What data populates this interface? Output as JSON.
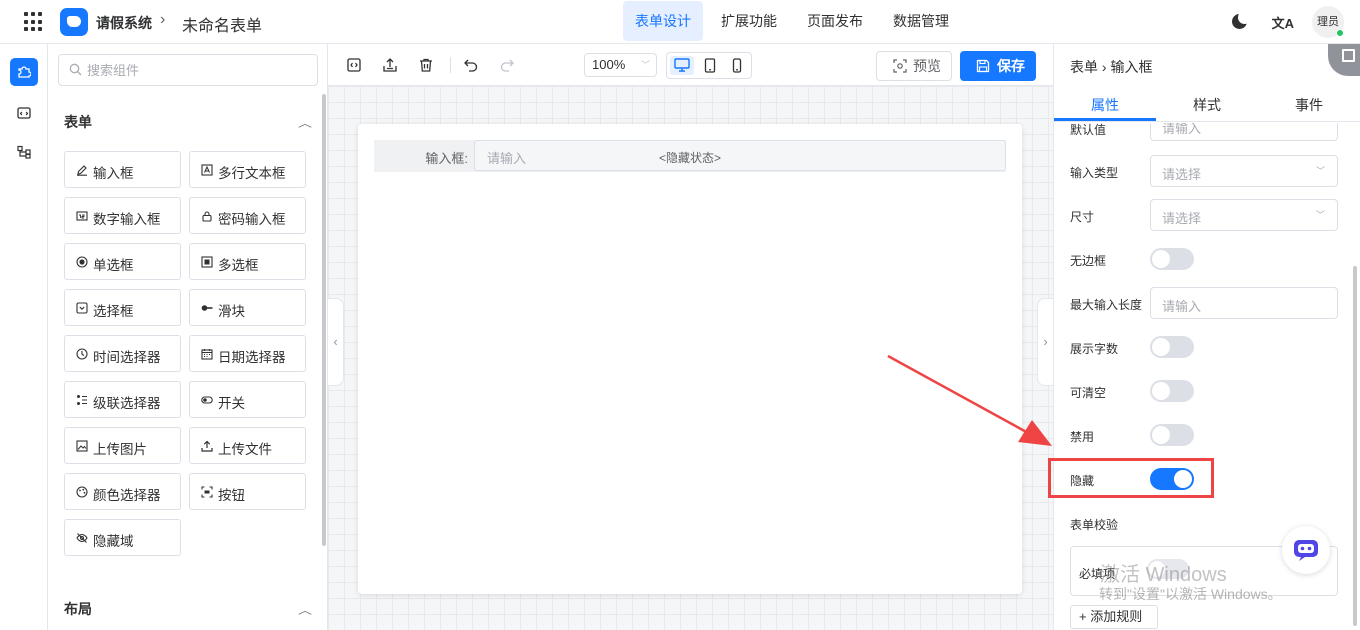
{
  "header": {
    "app_title": "请假系统",
    "crumb_sep": "›",
    "form_name": "未命名表单",
    "nav": [
      {
        "label": "表单设计",
        "active": true
      },
      {
        "label": "扩展功能",
        "active": false
      },
      {
        "label": "页面发布",
        "active": false
      },
      {
        "label": "数据管理",
        "active": false
      }
    ],
    "lang_icon": "文A",
    "user": "理员",
    "accent": "#1677ff"
  },
  "components": {
    "search_placeholder": "搜索组件",
    "sections": [
      {
        "title": "表单",
        "items": [
          {
            "label": "输入框",
            "icon": "pencil-icon"
          },
          {
            "label": "多行文本框",
            "icon": "textarea-icon"
          },
          {
            "label": "数字输入框",
            "icon": "number-icon"
          },
          {
            "label": "密码输入框",
            "icon": "lock-icon"
          },
          {
            "label": "单选框",
            "icon": "radio-icon"
          },
          {
            "label": "多选框",
            "icon": "checkbox-icon"
          },
          {
            "label": "选择框",
            "icon": "select-icon"
          },
          {
            "label": "滑块",
            "icon": "slider-icon"
          },
          {
            "label": "时间选择器",
            "icon": "clock-icon"
          },
          {
            "label": "日期选择器",
            "icon": "calendar-icon"
          },
          {
            "label": "级联选择器",
            "icon": "cascader-icon"
          },
          {
            "label": "开关",
            "icon": "toggle-icon"
          },
          {
            "label": "上传图片",
            "icon": "image-icon"
          },
          {
            "label": "上传文件",
            "icon": "upload-icon"
          },
          {
            "label": "颜色选择器",
            "icon": "palette-icon"
          },
          {
            "label": "按钮",
            "icon": "button-icon"
          },
          {
            "label": "隐藏域",
            "icon": "eye-off-icon"
          }
        ]
      },
      {
        "title": "布局",
        "items": []
      }
    ]
  },
  "toolbar": {
    "zoom": "100%",
    "preview_label": "预览",
    "save_label": "保存"
  },
  "canvas": {
    "field_label": "输入框:",
    "field_placeholder": "请输入",
    "hidden_tag": "<隐藏状态>"
  },
  "props": {
    "breadcrumb": "表单 › 输入框",
    "tabs": [
      {
        "label": "属性",
        "active": true
      },
      {
        "label": "样式",
        "active": false
      },
      {
        "label": "事件",
        "active": false
      }
    ],
    "default_label": "默认值",
    "default_placeholder": "请输入",
    "input_type_label": "输入类型",
    "input_type_placeholder": "请选择",
    "size_label": "尺寸",
    "size_placeholder": "请选择",
    "borderless_label": "无边框",
    "borderless": false,
    "maxlength_label": "最大输入长度",
    "maxlength_placeholder": "请输入",
    "show_count_label": "展示字数",
    "show_count": false,
    "clearable_label": "可清空",
    "clearable": false,
    "disabled_label": "禁用",
    "disabled": false,
    "hidden_label": "隐藏",
    "hidden": true,
    "validation_title": "表单校验",
    "required_label": "必填项",
    "add_rule_label": "+ 添加规则"
  },
  "overlay": {
    "watermark_line1": "激活 Windows",
    "watermark_line2": "转到\"设置\"以激活 Windows。",
    "annotation_color": "#ef4444"
  }
}
